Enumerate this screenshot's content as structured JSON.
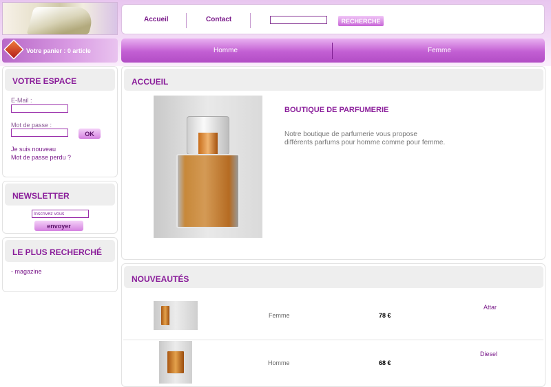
{
  "header": {
    "nav": [
      {
        "label": "Accueil"
      },
      {
        "label": "Contact"
      }
    ],
    "search": {
      "value": "",
      "button_label": "RECHERCHE"
    }
  },
  "cart": {
    "label": "Votre panier : 0 article"
  },
  "categories": [
    {
      "label": "Homme"
    },
    {
      "label": "Femme"
    }
  ],
  "sidebar": {
    "account": {
      "title": "VOTRE ESPACE",
      "email_label": "E-Mail :",
      "password_label": "Mot de passe :",
      "ok_label": "OK",
      "new_user_link": "Je suis nouveau",
      "lost_password_link": "Mot de passe perdu ?"
    },
    "newsletter": {
      "title": "NEWSLETTER",
      "placeholder": "Inscrivez vous",
      "button_label": "envoyer"
    },
    "popular": {
      "title": "LE PLUS RECHERCHÉ",
      "items": [
        "- magazine"
      ]
    }
  },
  "main": {
    "home": {
      "title": "ACCUEIL",
      "heading": "BOUTIQUE DE PARFUMERIE",
      "text_line1": "Notre boutique de parfumerie vous propose",
      "text_line2": "différents parfums pour homme comme pour femme."
    },
    "new_items": {
      "title": "NOUVEAUTÉS",
      "rows": [
        {
          "category": "Femme",
          "price": "78 €",
          "name": "Attar"
        },
        {
          "category": "Homme",
          "price": "68 €",
          "name": "Diesel"
        }
      ]
    }
  },
  "colors": {
    "accent": "#8a1d9a",
    "bar": "#c25fd3"
  },
  "icons": {
    "cart": "cart-icon"
  }
}
